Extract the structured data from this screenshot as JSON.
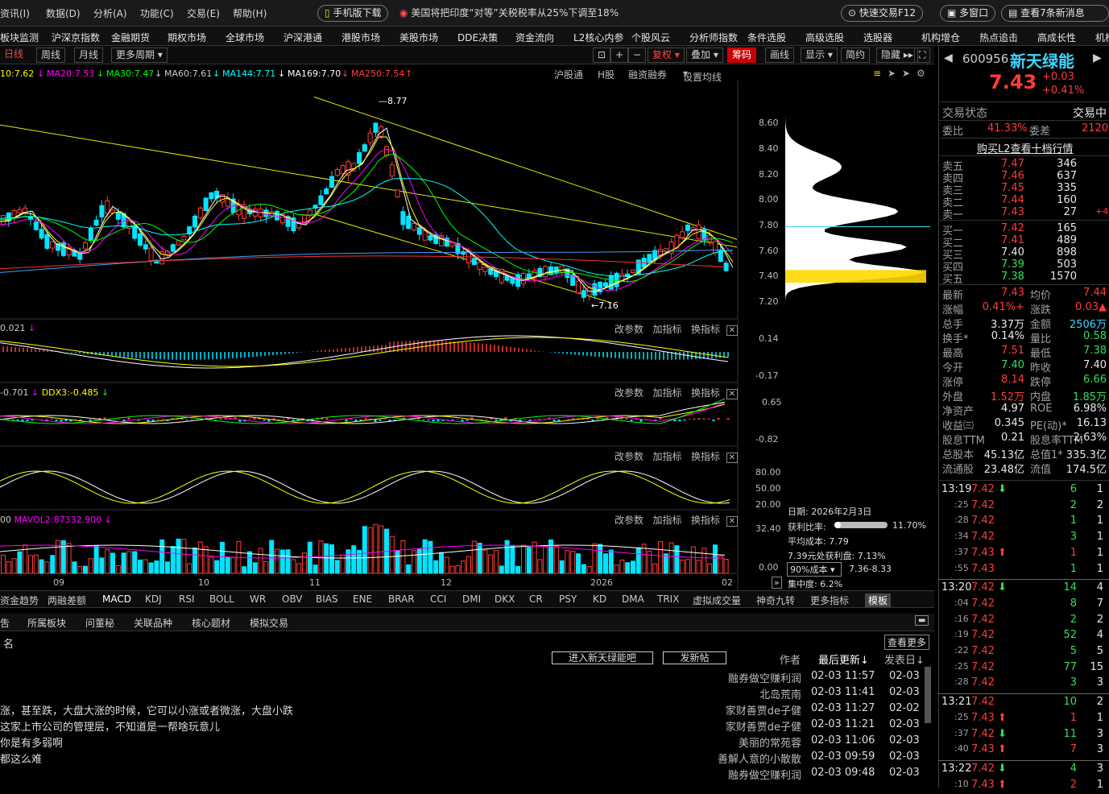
{
  "menu": [
    "资讯(I)",
    "数据(D)",
    "分析(A)",
    "功能(C)",
    "交易(E)",
    "帮助(H)"
  ],
  "pills": {
    "mobile": "手机版下载",
    "news": "美国将把印度“对等”关税税率从25%下调至18%",
    "quick": "快速交易F12",
    "multi": "多窗口",
    "newsmsg": "查看7条新消息"
  },
  "nav": [
    "板块监测",
    "沪深京指数",
    "金融期货",
    "期权市场",
    "全球市场",
    "沪深港通",
    "港股市场",
    "美股市场",
    "DDE决策",
    "资金流向",
    "L2核心内参",
    "个股风云",
    "分析师指数",
    "条件选股",
    "高级选股",
    "选股器",
    "机构增仓",
    "热点追击",
    "高成长性",
    "机构"
  ],
  "toolbar": {
    "periods": [
      "日线",
      "周线",
      "月线",
      "更多周期"
    ],
    "fq": "复权",
    "add": "叠加",
    "chip": "筹码",
    "draw": "画线",
    "show": "显示",
    "simple": "简约",
    "hide": "隐藏"
  },
  "ma": {
    "ma10": "10:7.62",
    "ma20": "MA20:7.53",
    "ma30": "MA30:7.47",
    "ma60": "MA60:7.61",
    "ma144": "MA144:7.71",
    "ma169": "MA169:7.70",
    "ma250": "MA250:7.54",
    "hgt": "沪股通",
    "hk": "H股",
    "margin": "融资融券",
    "setma": "设置均线"
  },
  "price_axis": [
    "8.60",
    "8.40",
    "8.20",
    "8.00",
    "7.80",
    "7.60",
    "7.40",
    "7.20"
  ],
  "annot": {
    "high": "8.77",
    "low": "7.16"
  },
  "macd": {
    "label": "0.021",
    "ticks": [
      "0.14",
      "-0.17"
    ]
  },
  "dde": {
    "label": "-0.701",
    "ddx3": "DDX3:-0.485",
    "ticks": [
      "0.65",
      "-0.82"
    ]
  },
  "kdj": {
    "ticks": [
      "80.00",
      "50.00",
      "20.00"
    ]
  },
  "vol": {
    "label": "00",
    "mavol2": "MAVOL2:87332.900",
    "ticks": [
      "32.40",
      "0.00"
    ]
  },
  "panel_tools": [
    "改参数",
    "加指标",
    "换指标"
  ],
  "months": [
    "09",
    "10",
    "11",
    "12",
    "2026",
    "02"
  ],
  "chip": {
    "date": "日期: 2026年2月3日",
    "ratio_label": "获利比率:",
    "ratio": "11.70%",
    "avg": "平均成本: 7.79",
    "profit": "7.39元处获利盘: 7.13%",
    "cost": "90%成本",
    "range": "7.36-8.33",
    "conc": "集中度: 6.2%"
  },
  "indicators": [
    "资金趋势",
    "两融差额",
    "MACD",
    "KDJ",
    "RSI",
    "BOLL",
    "WR",
    "OBV",
    "BIAS",
    "ENE",
    "BRAR",
    "CCI",
    "DMI",
    "DKX",
    "CR",
    "PSY",
    "KD",
    "DMA",
    "TRIX",
    "虚拟成交量",
    "神奇九转",
    "更多指标",
    "模板"
  ],
  "infotabs": [
    "吿",
    "所属板块",
    "问董秘",
    "关联品种",
    "核心题材",
    "模拟交易"
  ],
  "forum": {
    "name": "名",
    "more": "查看更多",
    "enter": "进入新天绿能吧",
    "post": "发新帖",
    "author": "作者",
    "updated": "最后更新↓",
    "posted": "发表日↓",
    "posts": [
      {
        "t": "",
        "a": "融券做空赚利润",
        "u": "02-03 11:57",
        "d": "02-03"
      },
      {
        "t": "",
        "a": "北岛荒南",
        "u": "02-03 11:41",
        "d": "02-03"
      },
      {
        "t": "涨，甚至跌，大盘大涨的时候，它可以小涨或者微涨，大盘小跌",
        "a": "家财善贾de子健",
        "u": "02-03 11:27",
        "d": "02-02"
      },
      {
        "t": "这家上市公司的管理层，不知道是一帮啥玩意儿",
        "a": "家财善贾de子健",
        "u": "02-03 11:21",
        "d": "02-03"
      },
      {
        "t": "你是有多弱啊",
        "a": "美丽的常苑蓉",
        "u": "02-03 11:06",
        "d": "02-03"
      },
      {
        "t": "都这么难",
        "a": "善解人意的小散散",
        "u": "02-03 09:59",
        "d": "02-03"
      },
      {
        "t": "",
        "a": "融券做空赚利润",
        "u": "02-03 09:48",
        "d": "02-03"
      }
    ]
  },
  "stock": {
    "code": "600956",
    "name": "新天绿能",
    "price": "7.43",
    "chg": "+0.03",
    "pct": "+0.41%",
    "status_label": "交易状态",
    "status": "交易中",
    "wb_label": "委比",
    "wb": "41.33%",
    "wc_label": "委差",
    "wc": "2120",
    "l2": "购买L2查看十档行情"
  },
  "asks": [
    [
      "卖五",
      "7.47",
      "346",
      ""
    ],
    [
      "卖四",
      "7.46",
      "637",
      ""
    ],
    [
      "卖三",
      "7.45",
      "335",
      ""
    ],
    [
      "卖二",
      "7.44",
      "160",
      ""
    ],
    [
      "卖一",
      "7.43",
      "27",
      "+4"
    ]
  ],
  "bids": [
    [
      "买一",
      "7.42",
      "165"
    ],
    [
      "买二",
      "7.41",
      "489"
    ],
    [
      "买三",
      "7.40",
      "898"
    ],
    [
      "买四",
      "7.39",
      "503"
    ],
    [
      "买五",
      "7.38",
      "1570"
    ]
  ],
  "stats": [
    [
      "最新",
      "7.43",
      "red",
      "均价",
      "7.44",
      "red"
    ],
    [
      "涨幅",
      "+0.41%",
      "red",
      "涨跌",
      "▲0.03",
      "red"
    ],
    [
      "总手",
      "3.37万",
      "wht",
      "金额",
      "2506万",
      "cy"
    ],
    [
      "换手*",
      "0.14%",
      "wht",
      "量比",
      "0.58",
      "grn"
    ],
    [
      "最高",
      "7.51",
      "red",
      "最低",
      "7.38",
      "grn"
    ],
    [
      "今开",
      "7.40",
      "grn",
      "昨收",
      "7.40",
      "wht"
    ],
    [
      "涨停",
      "8.14",
      "red",
      "跌停",
      "6.66",
      "grn"
    ],
    [
      "外盘",
      "1.52万",
      "red",
      "内盘",
      "1.85万",
      "grn"
    ],
    [
      "净资产",
      "4.97",
      "wht",
      "ROE",
      "6.98%",
      "wht"
    ],
    [
      "收益㈢",
      "0.345",
      "wht",
      "PE(动)*",
      "16.13",
      "wht"
    ],
    [
      "股息TTM",
      "0.21",
      "wht",
      "股息率TTM",
      "2.63%",
      "wht"
    ],
    [
      "总股本",
      "45.13亿",
      "wht",
      "总值1*",
      "335.3亿",
      "wht"
    ],
    [
      "流通股",
      "23.48亿",
      "wht",
      "流值",
      "174.5亿",
      "wht"
    ]
  ],
  "ticks": [
    {
      "t": "13:19",
      "p": "7.42",
      "dir": "down",
      "v": "6",
      "n": "1",
      "h": true
    },
    {
      "t": ":25",
      "p": "7.42",
      "dir": "",
      "v": "2",
      "n": "2"
    },
    {
      "t": ":28",
      "p": "7.42",
      "dir": "",
      "v": "1",
      "n": "1"
    },
    {
      "t": ":34",
      "p": "7.42",
      "dir": "",
      "v": "3",
      "n": "1"
    },
    {
      "t": ":37",
      "p": "7.43",
      "dir": "up",
      "v": "1",
      "n": "1"
    },
    {
      "t": ":55",
      "p": "7.43",
      "dir": "",
      "v": "1",
      "n": "1"
    },
    {
      "t": "13:20",
      "p": "7.42",
      "dir": "down",
      "v": "14",
      "n": "4",
      "h": true
    },
    {
      "t": ":04",
      "p": "7.42",
      "dir": "",
      "v": "8",
      "n": "7"
    },
    {
      "t": ":16",
      "p": "7.42",
      "dir": "",
      "v": "2",
      "n": "2"
    },
    {
      "t": ":19",
      "p": "7.42",
      "dir": "",
      "v": "52",
      "n": "4"
    },
    {
      "t": ":22",
      "p": "7.42",
      "dir": "",
      "v": "5",
      "n": "5"
    },
    {
      "t": ":25",
      "p": "7.42",
      "dir": "",
      "v": "77",
      "n": "15"
    },
    {
      "t": ":28",
      "p": "7.42",
      "dir": "",
      "v": "3",
      "n": "3"
    },
    {
      "t": "13:21",
      "p": "7.42",
      "dir": "",
      "v": "10",
      "n": "2",
      "h": true
    },
    {
      "t": ":25",
      "p": "7.43",
      "dir": "up",
      "v": "1",
      "n": "1"
    },
    {
      "t": ":37",
      "p": "7.42",
      "dir": "down",
      "v": "11",
      "n": "3"
    },
    {
      "t": ":40",
      "p": "7.43",
      "dir": "up",
      "v": "7",
      "n": "3"
    },
    {
      "t": "13:22",
      "p": "7.42",
      "dir": "down",
      "v": "4",
      "n": "3",
      "h": true
    },
    {
      "t": ":10",
      "p": "7.43",
      "dir": "up",
      "v": "2",
      "n": "1"
    }
  ],
  "colors": {
    "up": "#ff3b3b",
    "down": "#00e5ff",
    "ma5": "#ffffff",
    "ma10": "#ffff00",
    "ma20": "#ff00ff",
    "ma30": "#00ff00",
    "ma60": "#00ffff",
    "trend": "#e6e600"
  }
}
